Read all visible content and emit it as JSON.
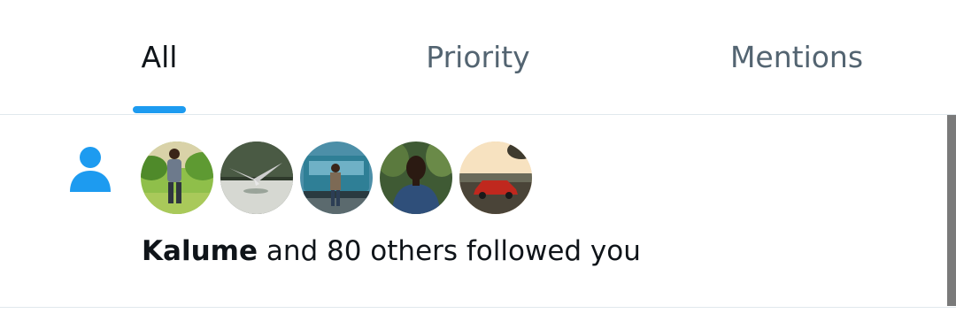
{
  "tabs": [
    {
      "label": "All",
      "active": true
    },
    {
      "label": "Priority",
      "active": false
    },
    {
      "label": "Mentions",
      "active": false
    }
  ],
  "notification": {
    "icon": "person-icon",
    "avatars": [
      "avatar-man-in-garden",
      "avatar-bird-over-water",
      "avatar-man-by-bus",
      "avatar-man-portrait",
      "avatar-red-car-sunset"
    ],
    "actor_name": "Kalume",
    "message": " and 80 others followed you"
  },
  "colors": {
    "accent": "#1d9bf0",
    "text_primary": "#0f1419",
    "text_secondary": "#536471",
    "divider": "#e1e8ed"
  }
}
